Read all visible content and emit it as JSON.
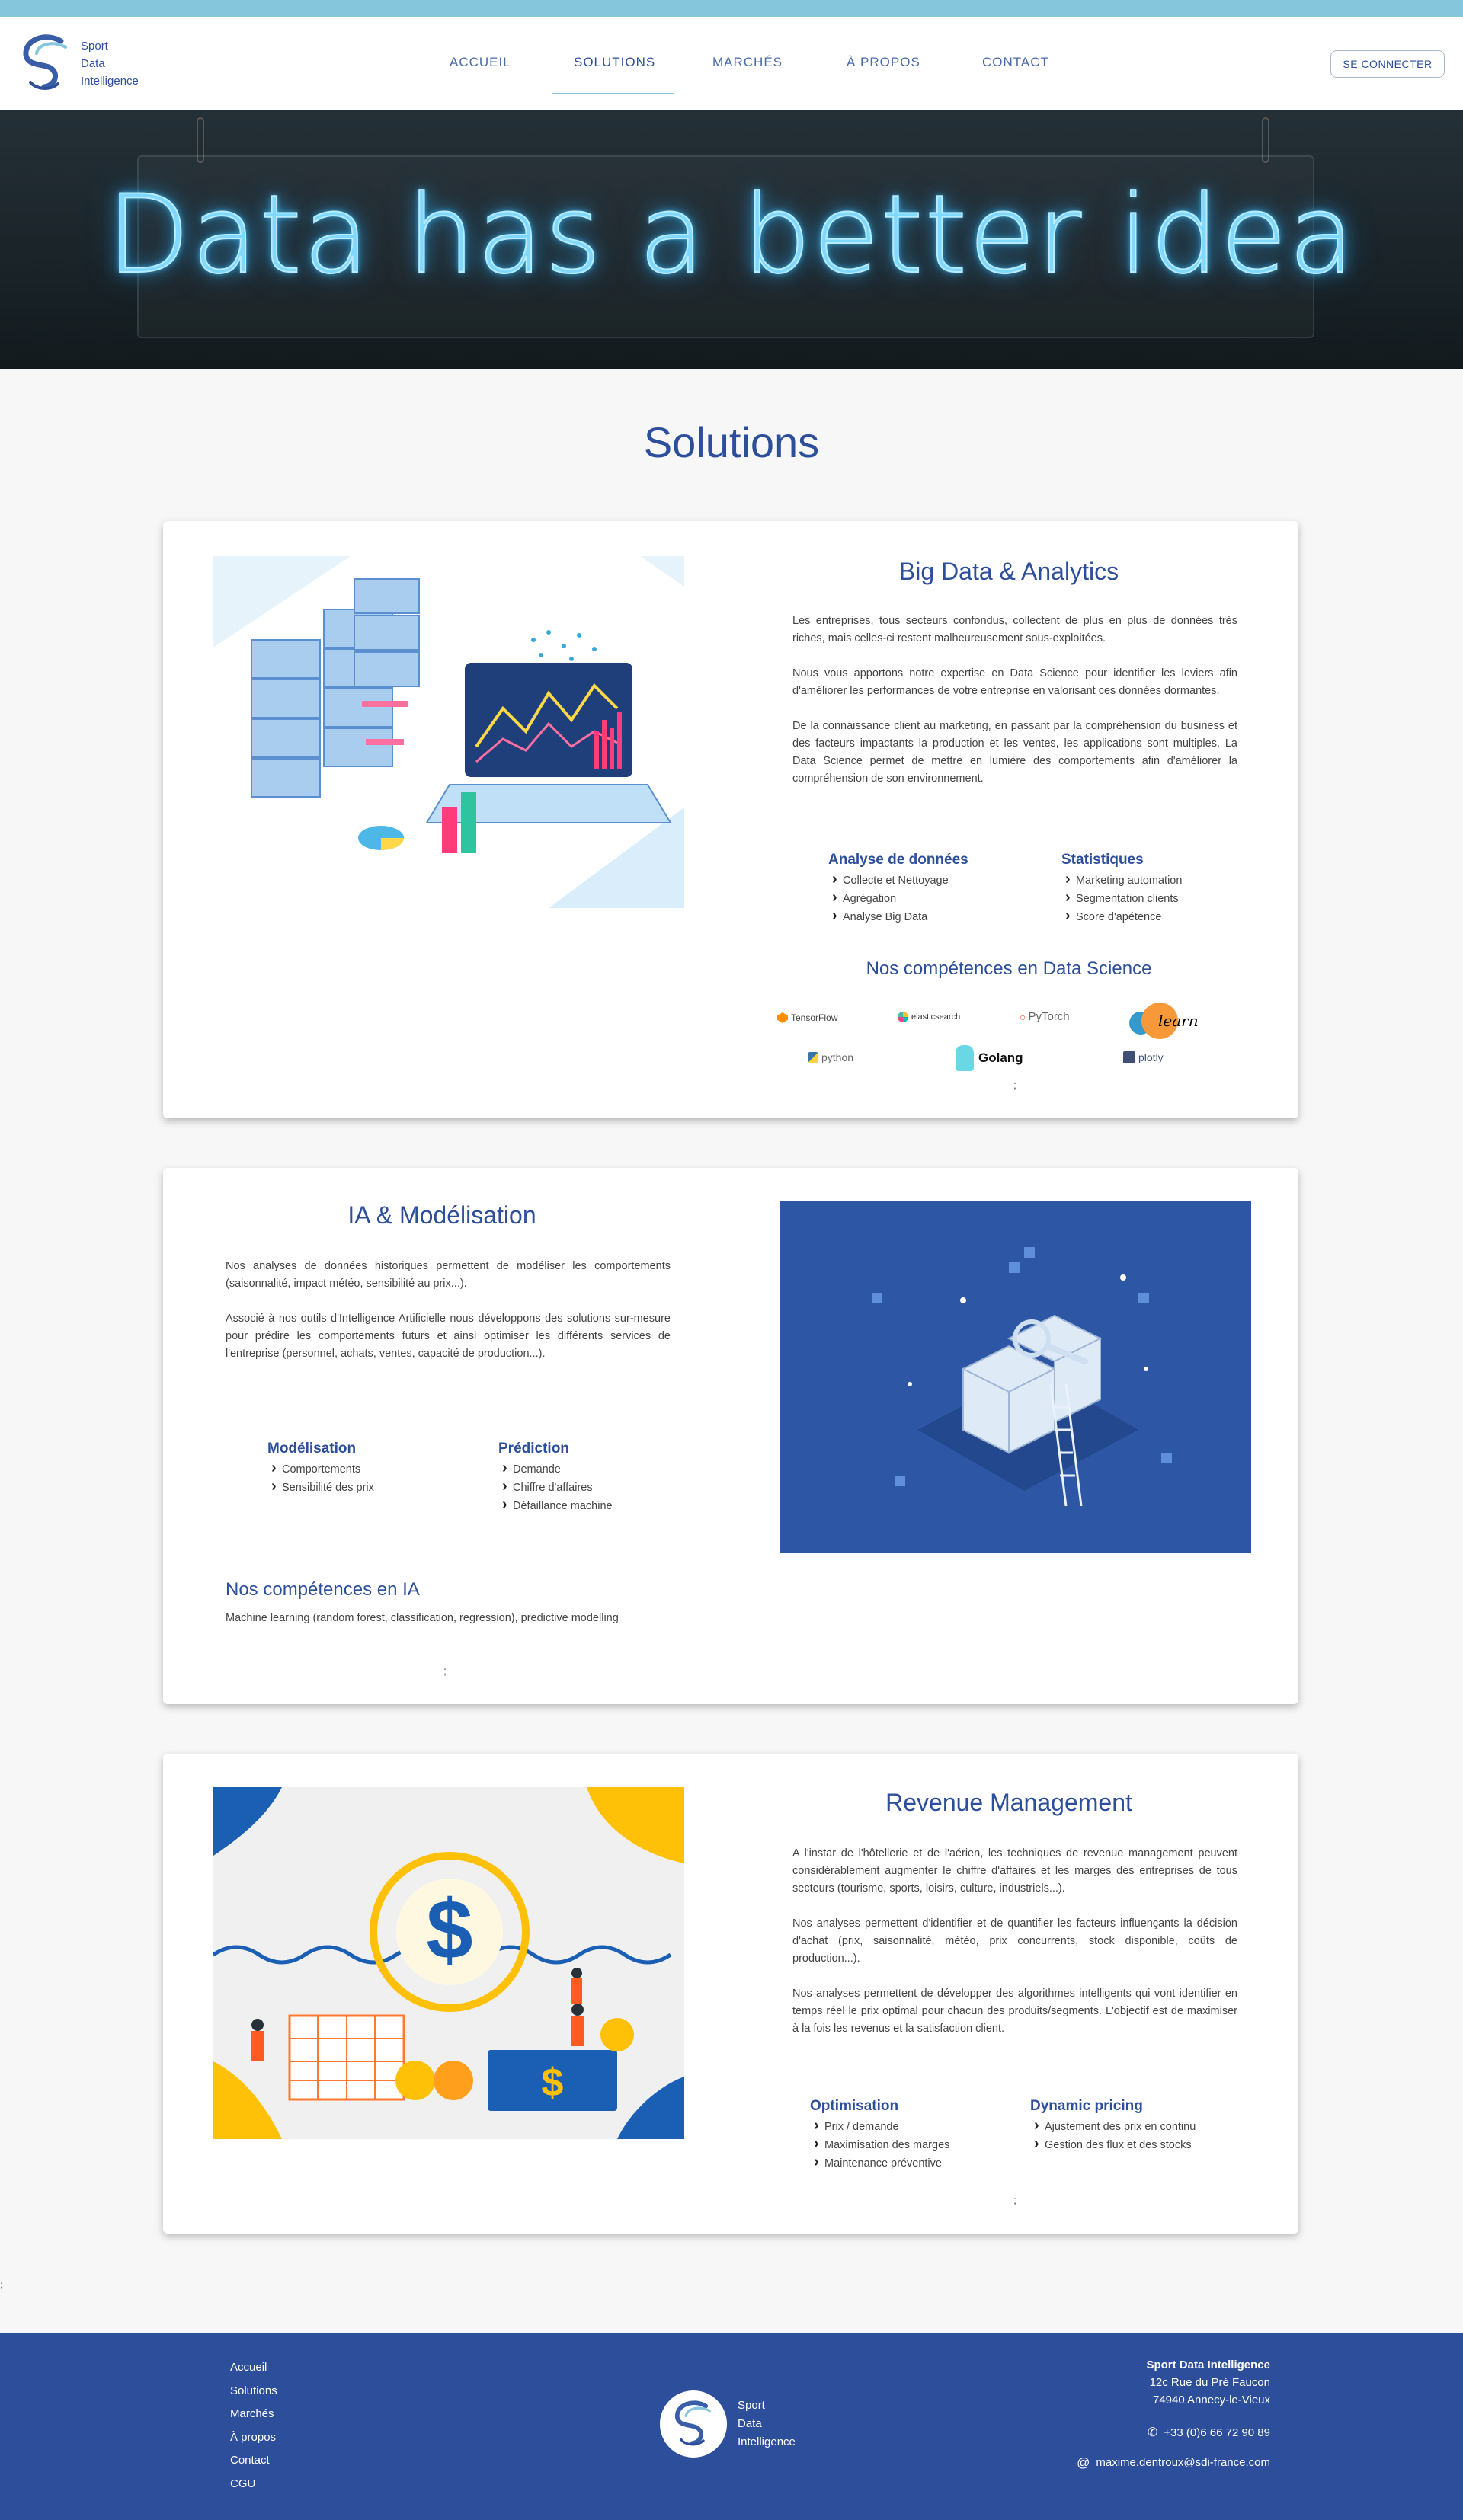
{
  "brand": {
    "line1": "Sport",
    "line2": "Data",
    "line3": "Intelligence"
  },
  "nav": {
    "items": [
      "Accueil",
      "Solutions",
      "Marchés",
      "À propos",
      "Contact"
    ],
    "active": "Solutions",
    "signin_label": "Se connecter"
  },
  "hero": {
    "text": "Data has a better idea"
  },
  "page": {
    "title": "Solutions"
  },
  "cards": [
    {
      "title": "Big Data & Analytics",
      "paragraphs": [
        "Les entreprises, tous secteurs confondus, collectent de plus en plus de données très riches, mais celles-ci restent malheureusement sous-exploitées.",
        "Nous vous apportons notre expertise en Data Science pour identifier les leviers afin d'améliorer les performances de votre entreprise en valorisant ces données dormantes.",
        "De la connaissance client au marketing, en passant par la compréhension du business et des facteurs impactants la production et les ventes, les applications sont multiples. La Data Science permet de mettre en lumière des comportements afin d'améliorer la compréhension de son environnement."
      ],
      "col1": {
        "title": "Analyse de données",
        "items": [
          "Collecte et Nettoyage",
          "Agrégation",
          "Analyse Big Data"
        ]
      },
      "col2": {
        "title": "Statistiques",
        "items": [
          "Marketing automation",
          "Segmentation clients",
          "Score d'apétence"
        ]
      },
      "skills_title": "Nos compétences en Data Science",
      "tools": [
        "TensorFlow",
        "elasticsearch",
        "PyTorch",
        "learn",
        "python",
        "Golang",
        "plotly"
      ],
      "semicolon": ";"
    },
    {
      "title": "IA & Modélisation",
      "paragraphs": [
        "Nos analyses de données historiques permettent de modéliser les comportements (saisonnalité, impact météo, sensibilité au prix...).",
        "Associé à nos outils d'Intelligence Artificielle nous développons des solutions sur-mesure pour prédire les comportements futurs et ainsi optimiser les différents services de l'entreprise (personnel, achats, ventes, capacité de production...)."
      ],
      "col1": {
        "title": "Modélisation",
        "items": [
          "Comportements",
          "Sensibilité des prix"
        ]
      },
      "col2": {
        "title": "Prédiction",
        "items": [
          "Demande",
          "Chiffre d'affaires",
          "Défaillance machine"
        ]
      },
      "skills_title": "Nos compétences en IA",
      "skills_text": "Machine learning (random forest, classification, regression), predictive modelling",
      "semicolon": ";"
    },
    {
      "title": "Revenue Management",
      "paragraphs": [
        "A l'instar de l'hôtellerie et de l'aérien, les techniques de revenue management peuvent considérablement augmenter le chiffre d'affaires et les marges des entreprises de tous secteurs (tourisme, sports, loisirs, culture, industriels...).",
        "Nos analyses permettent d'identifier et de quantifier les facteurs influençants la décision d'achat (prix, saisonnalité, météo, prix concurrents, stock disponible, coûts de production...).",
        "Nos analyses permettent de développer des algorithmes intelligents qui vont identifier en temps réel le prix optimal pour chacun des produits/segments. L'objectif est de maximiser à la fois les revenus et la satisfaction client."
      ],
      "col1": {
        "title": "Optimisation",
        "items": [
          "Prix / demande",
          "Maximisation des marges",
          "Maintenance préventive"
        ]
      },
      "col2": {
        "title": "Dynamic pricing",
        "items": [
          "Ajustement des prix en continu",
          "Gestion des flux et des stocks"
        ]
      },
      "semicolon": ";"
    }
  ],
  "stray_semicolon": ";",
  "footer": {
    "links": [
      "Accueil",
      "Solutions",
      "Marchés",
      "À propos",
      "Contact",
      "CGU"
    ],
    "company": "Sport Data Intelligence",
    "address1": "12c Rue du Pré Faucon",
    "address2": "74940 Annecy-le-Vieux",
    "phone": "+33 (0)6 66 72 90 89",
    "email": "maxime.dentroux@sdi-france.com"
  },
  "colors": {
    "brand": "#2d4e9a",
    "topbar": "#86c6dc",
    "footer": "#2d4e9a"
  }
}
